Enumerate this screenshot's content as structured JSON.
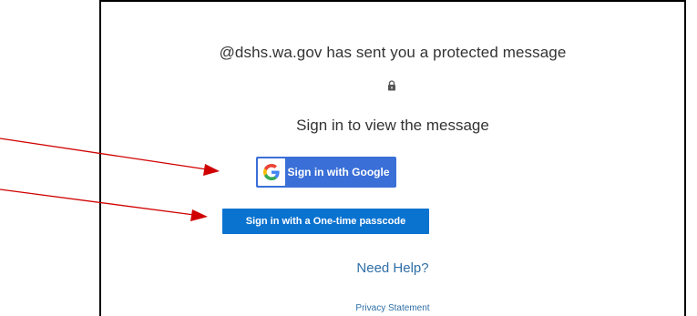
{
  "message": {
    "sender_line": "@dshs.wa.gov has sent you a protected message",
    "lock_icon": "lock-icon",
    "signin_heading": "Sign in to view the message"
  },
  "buttons": {
    "google_label": "Sign in with Google",
    "google_icon": "google-g-icon",
    "otp_label": "Sign in with a One-time passcode"
  },
  "links": {
    "help": "Need Help?",
    "privacy": "Privacy Statement"
  },
  "annotations": {
    "arrow_color": "#d00000",
    "arrows": [
      "arrow-to-google-button",
      "arrow-to-otp-button"
    ]
  },
  "colors": {
    "google_blue": "#3a6fd8",
    "otp_blue": "#0a72cf",
    "link_blue": "#2f6fa8"
  }
}
